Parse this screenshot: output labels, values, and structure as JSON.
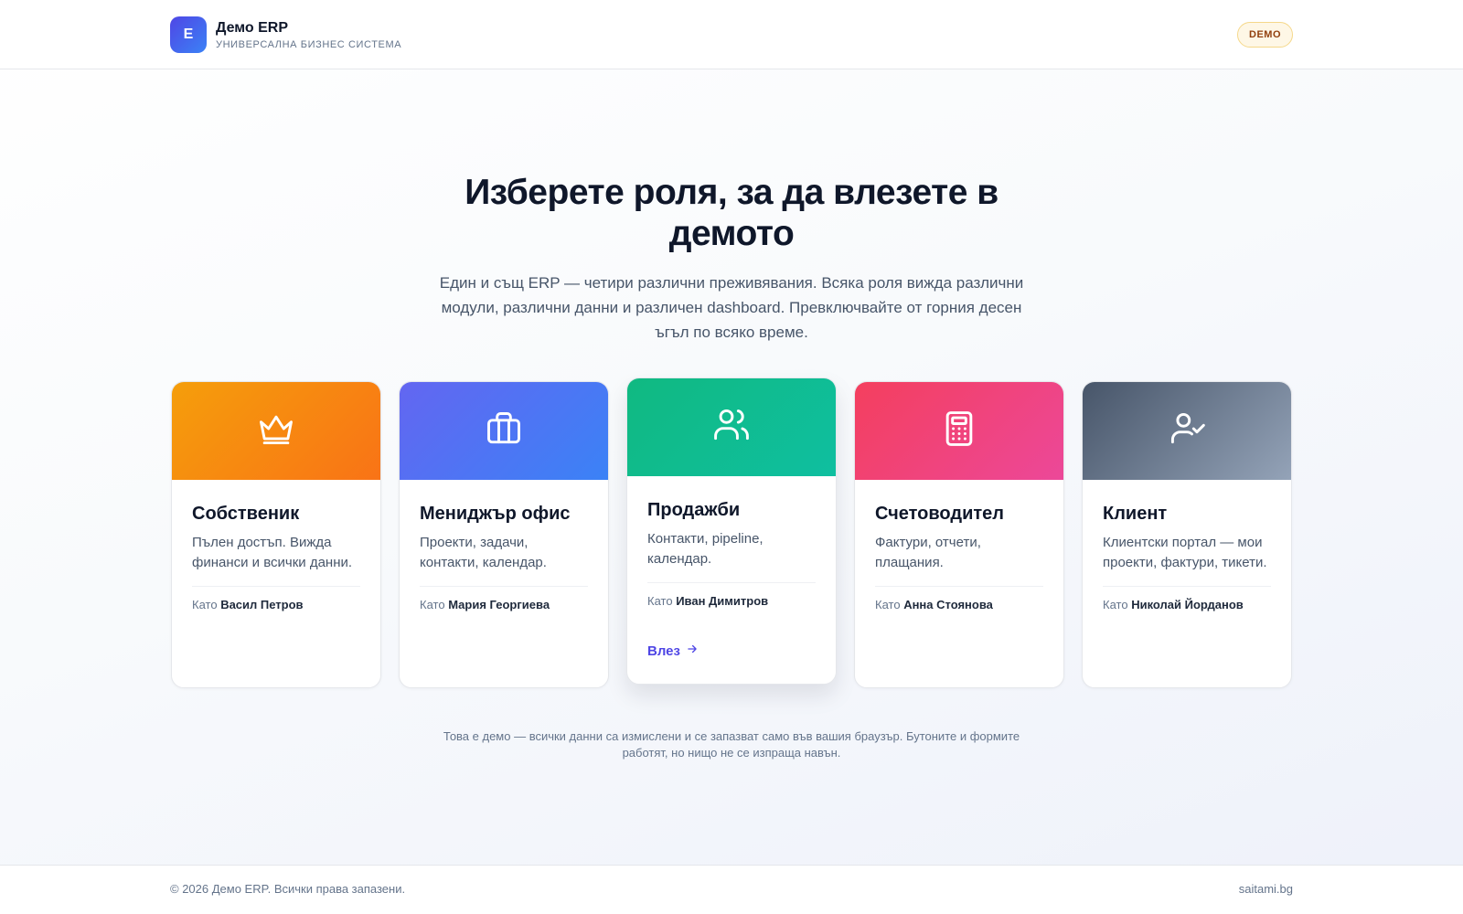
{
  "header": {
    "logo_letter": "E",
    "brand_name": "Демо ERP",
    "brand_subtitle": "УНИВЕРСАЛНА БИЗНЕС СИСТЕМА",
    "badge": "DEMO"
  },
  "hero": {
    "title": "Изберете роля, за да влезете в демото",
    "subtitle": "Един и същ ERP — четири различни преживявания. Всяка роля вижда различни модули, различни данни и различен dashboard. Превключвайте от горния десен ъгъл по всяко време."
  },
  "as_label": "Като",
  "roles": [
    {
      "title": "Собственик",
      "description": "Пълен достъп. Вижда финанси и всички данни.",
      "as_user": "Васил Петров",
      "icon": "crown-icon",
      "gradient": [
        "#f59e0b",
        "#f97316"
      ]
    },
    {
      "title": "Мениджър офис",
      "description": "Проекти, задачи, контакти, календар.",
      "as_user": "Мария Георгиева",
      "icon": "briefcase-icon",
      "gradient": [
        "#6366f1",
        "#3b82f6"
      ]
    },
    {
      "title": "Продажби",
      "description": "Контакти, pipeline, календар.",
      "as_user": "Иван Димитров",
      "icon": "users-icon",
      "gradient": [
        "#10b981",
        "#0fbfa0"
      ],
      "enter_label": "Влез"
    },
    {
      "title": "Счетоводител",
      "description": "Фактури, отчети, плащания.",
      "as_user": "Анна Стоянова",
      "icon": "calculator-icon",
      "gradient": [
        "#f43f5e",
        "#ec4899"
      ]
    },
    {
      "title": "Клиент",
      "description": "Клиентски портал — мои проекти, фактури, тикети.",
      "as_user": "Николай Йорданов",
      "icon": "user-check-icon",
      "gradient": [
        "#475569",
        "#94a3b8"
      ]
    }
  ],
  "note": "Това е демо — всички данни са измислени и се запазват само във вашия браузър. Бутоните и формите работят, но нищо не се изпраща навън.",
  "footer": {
    "copyright": "© 2026 Демо ERP. Всички права запазени.",
    "link": "saitami.bg"
  }
}
